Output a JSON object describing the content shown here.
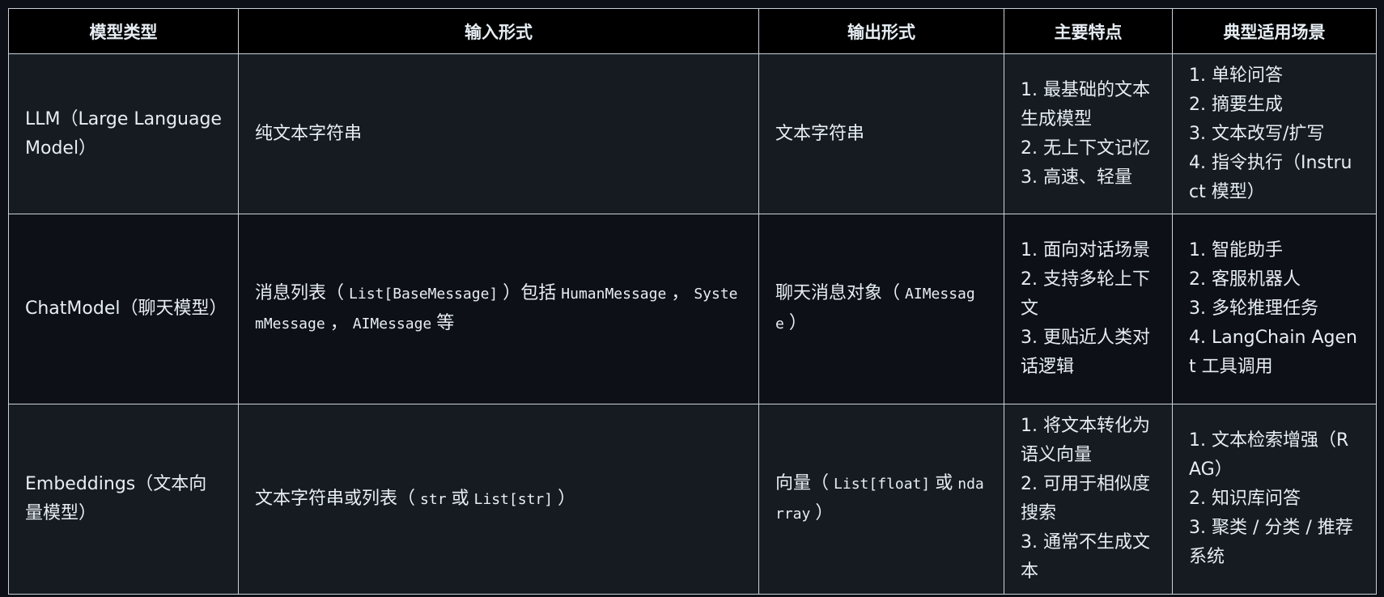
{
  "headers": [
    "模型类型",
    "输入形式",
    "输出形式",
    "主要特点",
    "典型适用场景"
  ],
  "rows": [
    {
      "type": "LLM（Large Language Model）",
      "input": "纯文本字符串",
      "output": "文本字符串",
      "features": [
        "1. 最基础的文本生成模型",
        "2. 无上下文记忆",
        "3. 高速、轻量"
      ],
      "scenarios": [
        "1. 单轮问答",
        "2. 摘要生成",
        "3. 文本改写/扩写",
        "4. 指令执行（Instruct 模型）"
      ]
    },
    {
      "type": "ChatModel（聊天模型）",
      "input": {
        "p1": "消息列表（",
        "code1": "List[BaseMessage]",
        "p2": "）包括",
        "code2": "HumanMessage",
        "p3": "，",
        "code3": "SystemMessage",
        "p4": "，",
        "code4": "AIMessage",
        "p5": "等"
      },
      "output": {
        "p1": "聊天消息对象（",
        "code1": "AIMessage",
        "p2": "）"
      },
      "features": [
        "1. 面向对话场景",
        "2. 支持多轮上下文",
        "3. 更贴近人类对话逻辑"
      ],
      "scenarios": [
        "1. 智能助手",
        "2. 客服机器人",
        "3. 多轮推理任务",
        "4. LangChain Agent 工具调用"
      ]
    },
    {
      "type": "Embeddings（文本向量模型）",
      "input": {
        "p1": "文本字符串或列表（",
        "code1": "str",
        "p2": "或",
        "code2": "List[str]",
        "p3": "）"
      },
      "output": {
        "p1": "向量（",
        "code1": "List[float]",
        "p2": "或",
        "code2": "ndarray",
        "p3": "）"
      },
      "features": [
        "1. 将文本转化为语义向量",
        "2. 可用于相似度搜索",
        "3. 通常不生成文本"
      ],
      "scenarios": [
        "1. 文本检索增强（RAG）",
        "2. 知识库问答",
        "3. 聚类 / 分类 / 推荐系统"
      ]
    }
  ]
}
